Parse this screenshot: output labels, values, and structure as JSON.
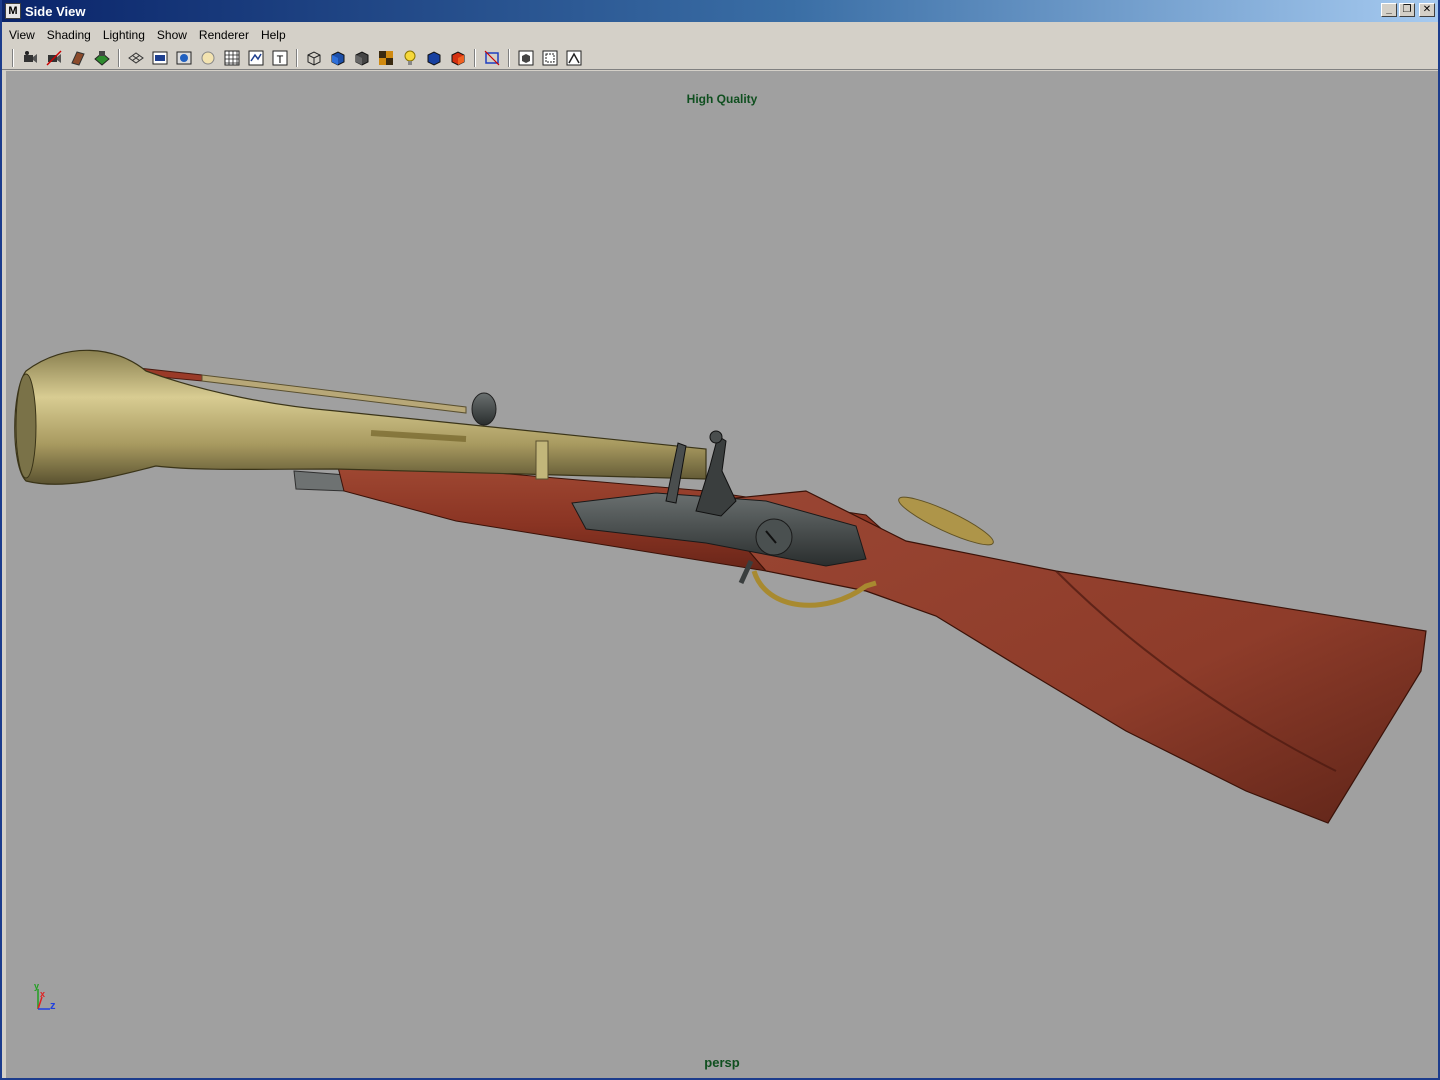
{
  "window": {
    "title": "Side View",
    "minimize_glyph": "_",
    "restore_glyph": "❐",
    "close_glyph": "✕"
  },
  "menu": {
    "items": [
      "View",
      "Shading",
      "Lighting",
      "Show",
      "Renderer",
      "Help"
    ]
  },
  "toolbar": {
    "icons": [
      "camera-select-icon",
      "camera-attributes-icon",
      "bookmark-icon",
      "image-plane-icon",
      "grid-icon",
      "film-gate-icon",
      "resolution-gate-icon",
      "gate-mask-icon",
      "field-chart-icon",
      "safe-action-icon",
      "safe-title-icon",
      "wireframe-icon",
      "smooth-shade-icon",
      "flat-shade-icon",
      "textured-icon",
      "lights-icon",
      "shadows-icon",
      "xray-icon",
      "isolate-select-icon",
      "frame-all-icon",
      "frame-selected-icon",
      "two-sided-lighting-icon"
    ]
  },
  "viewport": {
    "renderer_label": "High Quality",
    "camera_label": "persp",
    "background_color": "#a0a0a0",
    "axis_labels": {
      "x": "x",
      "y": "y",
      "z": "z"
    }
  }
}
